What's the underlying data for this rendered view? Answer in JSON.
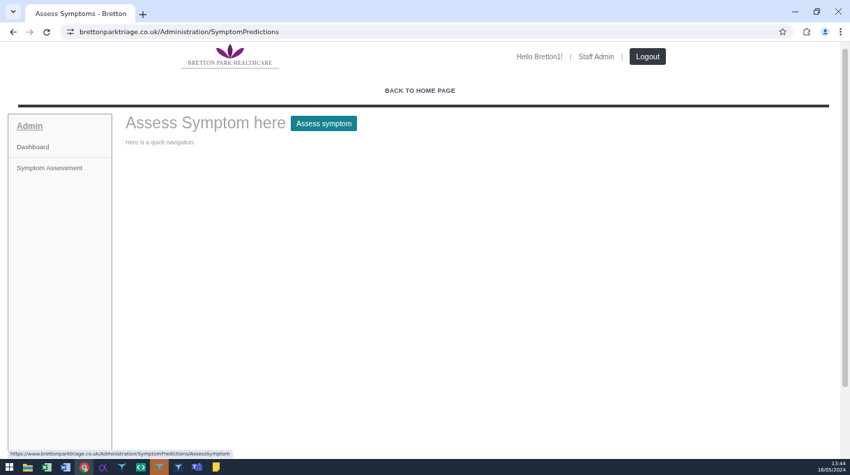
{
  "browser": {
    "tab": {
      "title": "Assess Symptoms - Bretton",
      "selected": true
    },
    "url": "brettonparktriage.co.uk/Administration/SymptomPredictions",
    "status_url": "https://www.brettonparktriage.co.uk/Administration/SymptomPredictions/AssessSymptom"
  },
  "header": {
    "logo_text": "BRETTON PARK HEALTHCARE",
    "greeting": "Hello Bretton1!",
    "separator_1": "|",
    "role": "Staff Admin",
    "separator_2": "|",
    "logout": "Logout",
    "home_link": "BACK TO HOME PAGE"
  },
  "sidebar": {
    "title": "Admin",
    "items": [
      {
        "label": "Dashboard",
        "selected": false
      },
      {
        "label": "Symptom Assessment",
        "selected": false
      }
    ]
  },
  "main": {
    "heading": "Assess Symptom here",
    "button": "Assess symptom",
    "text": "Here is a quick navigation:"
  },
  "taskbar": {
    "apps": [
      {
        "kind": "explorer",
        "active": false,
        "flashing": false
      },
      {
        "kind": "excel",
        "active": false,
        "flashing": false
      },
      {
        "kind": "word",
        "active": false,
        "flashing": false
      },
      {
        "kind": "chrome",
        "active": true,
        "flashing": false
      },
      {
        "kind": "alpha",
        "active": false,
        "flashing": false
      },
      {
        "kind": "tool",
        "active": false,
        "flashing": false
      },
      {
        "kind": "code",
        "active": false,
        "flashing": false
      },
      {
        "kind": "tool",
        "active": false,
        "flashing": true
      },
      {
        "kind": "tooldark",
        "active": false,
        "flashing": false
      },
      {
        "kind": "teams",
        "active": false,
        "flashing": false
      },
      {
        "kind": "note",
        "active": false,
        "flashing": false
      }
    ],
    "time": "13:44",
    "date": "16/05/2024"
  }
}
